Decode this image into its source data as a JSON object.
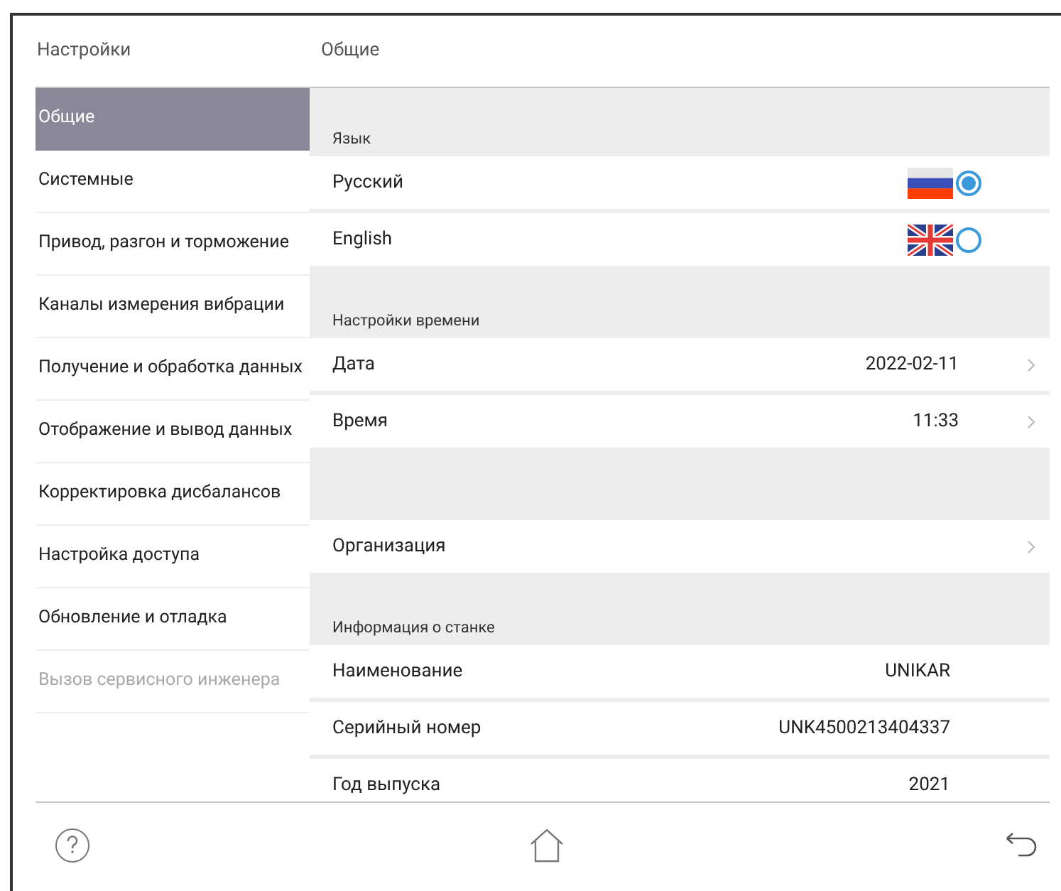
{
  "header": {
    "title": "Настройки",
    "section_title": "Общие"
  },
  "sidebar": {
    "items": [
      {
        "label": "Общие",
        "selected": true,
        "disabled": false
      },
      {
        "label": "Системные",
        "selected": false,
        "disabled": false
      },
      {
        "label": "Привод, разгон и торможение",
        "selected": false,
        "disabled": false
      },
      {
        "label": "Каналы измерения вибрации",
        "selected": false,
        "disabled": false
      },
      {
        "label": "Получение и обработка данных",
        "selected": false,
        "disabled": false
      },
      {
        "label": "Отображение и вывод данных",
        "selected": false,
        "disabled": false
      },
      {
        "label": "Корректировка дисбалансов",
        "selected": false,
        "disabled": false
      },
      {
        "label": "Настройка доступа",
        "selected": false,
        "disabled": false
      },
      {
        "label": "Обновление и отладка",
        "selected": false,
        "disabled": false
      },
      {
        "label": "Вызов сервисного инженера",
        "selected": false,
        "disabled": true
      }
    ]
  },
  "sections": [
    {
      "title": "Язык",
      "rows": [
        {
          "kind": "radio",
          "label": "Русский",
          "flag": {
            "kind": "ru"
          },
          "selected": true
        },
        {
          "kind": "radio",
          "label": "English",
          "flag": {
            "kind": "gb"
          },
          "selected": false
        }
      ]
    },
    {
      "title": "Настройки времени",
      "rows": [
        {
          "kind": "nav",
          "label": "Дата",
          "value": "2022-02-11"
        },
        {
          "kind": "nav",
          "label": "Время",
          "value": "11:33"
        }
      ]
    },
    {
      "rows": [
        {
          "kind": "nav",
          "label": "Организация"
        }
      ]
    },
    {
      "title": "Информация о станке",
      "rows": [
        {
          "kind": "info",
          "label": "Наименование",
          "value": "UNIKAR"
        },
        {
          "kind": "info",
          "label": "Серийный номер",
          "value": "UNK4500213404337"
        },
        {
          "kind": "info",
          "label": "Год выпуска",
          "value": "2021"
        }
      ]
    }
  ]
}
